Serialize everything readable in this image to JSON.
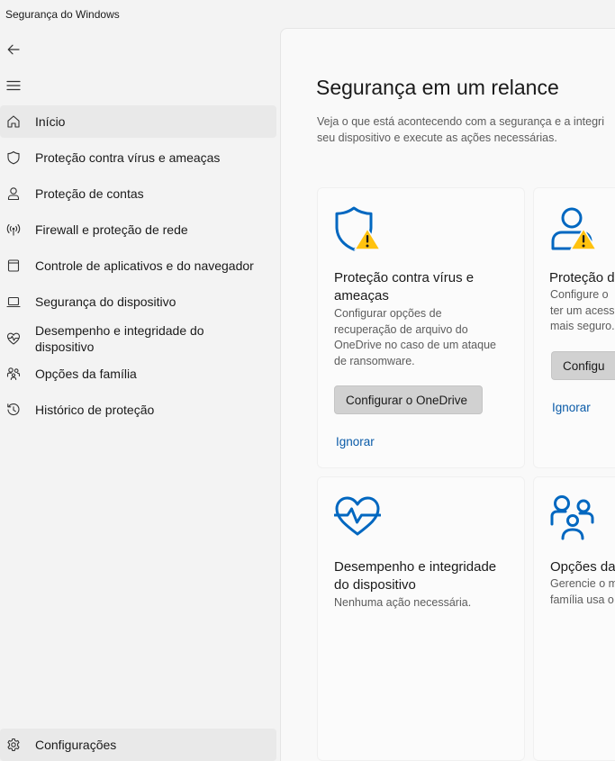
{
  "window": {
    "title": "Segurança do Windows"
  },
  "nav": {
    "back_icon": "back-arrow-icon",
    "menu_icon": "hamburger-menu-icon"
  },
  "sidebar": {
    "items": [
      {
        "label": "Início",
        "icon": "home-icon",
        "selected": true
      },
      {
        "label": "Proteção contra vírus e ameaças",
        "icon": "shield-icon"
      },
      {
        "label": "Proteção de contas",
        "icon": "person-icon"
      },
      {
        "label": "Firewall e proteção de rede",
        "icon": "wireless-icon"
      },
      {
        "label": "Controle de aplicativos e do navegador",
        "icon": "app-window-icon"
      },
      {
        "label": "Segurança do dispositivo",
        "icon": "laptop-icon"
      },
      {
        "label": "Desempenho e integridade do dispositivo",
        "label_lines": [
          "Desempenho e integridade do",
          "dispositivo"
        ],
        "icon": "heart-pulse-icon"
      },
      {
        "label": "Opções da família",
        "icon": "family-icon"
      },
      {
        "label": "Histórico de proteção",
        "icon": "history-icon"
      }
    ],
    "settings": {
      "label": "Configurações",
      "icon": "gear-icon"
    }
  },
  "main": {
    "title": "Segurança em um relance",
    "description_lines": [
      "Veja o que está acontecendo com a segurança e a integri",
      "seu dispositivo e execute as ações necessárias."
    ],
    "cards": [
      {
        "title_lines": [
          "Proteção contra vírus e",
          "ameaças"
        ],
        "desc_lines": [
          "Configurar opções de",
          "recuperação de arquivo do",
          "OneDrive no caso de um ataque",
          "de ransomware."
        ],
        "button": "Configurar o OneDrive",
        "link": "Ignorar",
        "icon": "shield-warning-icon"
      },
      {
        "title_lines": [
          "Proteção d"
        ],
        "desc_lines": [
          "Configure o",
          "ter um acess",
          "mais seguro."
        ],
        "button": "Configu",
        "link": "Ignorar",
        "icon": "person-warning-icon"
      },
      {
        "title_lines": [
          "Desempenho e integridade",
          "do dispositivo"
        ],
        "desc_lines": [
          "Nenhuma ação necessária."
        ],
        "icon": "heart-pulse-icon"
      },
      {
        "title_lines": [
          "Opções da"
        ],
        "desc_lines": [
          "Gerencie o m",
          "família usa o"
        ],
        "icon": "family-icon"
      }
    ]
  },
  "colors": {
    "accent": "#0067c0",
    "link": "#0a5ba8",
    "warning": "#ffc20e",
    "sidebar_selected": "#e9e9e9",
    "button_bg": "#d1d1d1"
  }
}
